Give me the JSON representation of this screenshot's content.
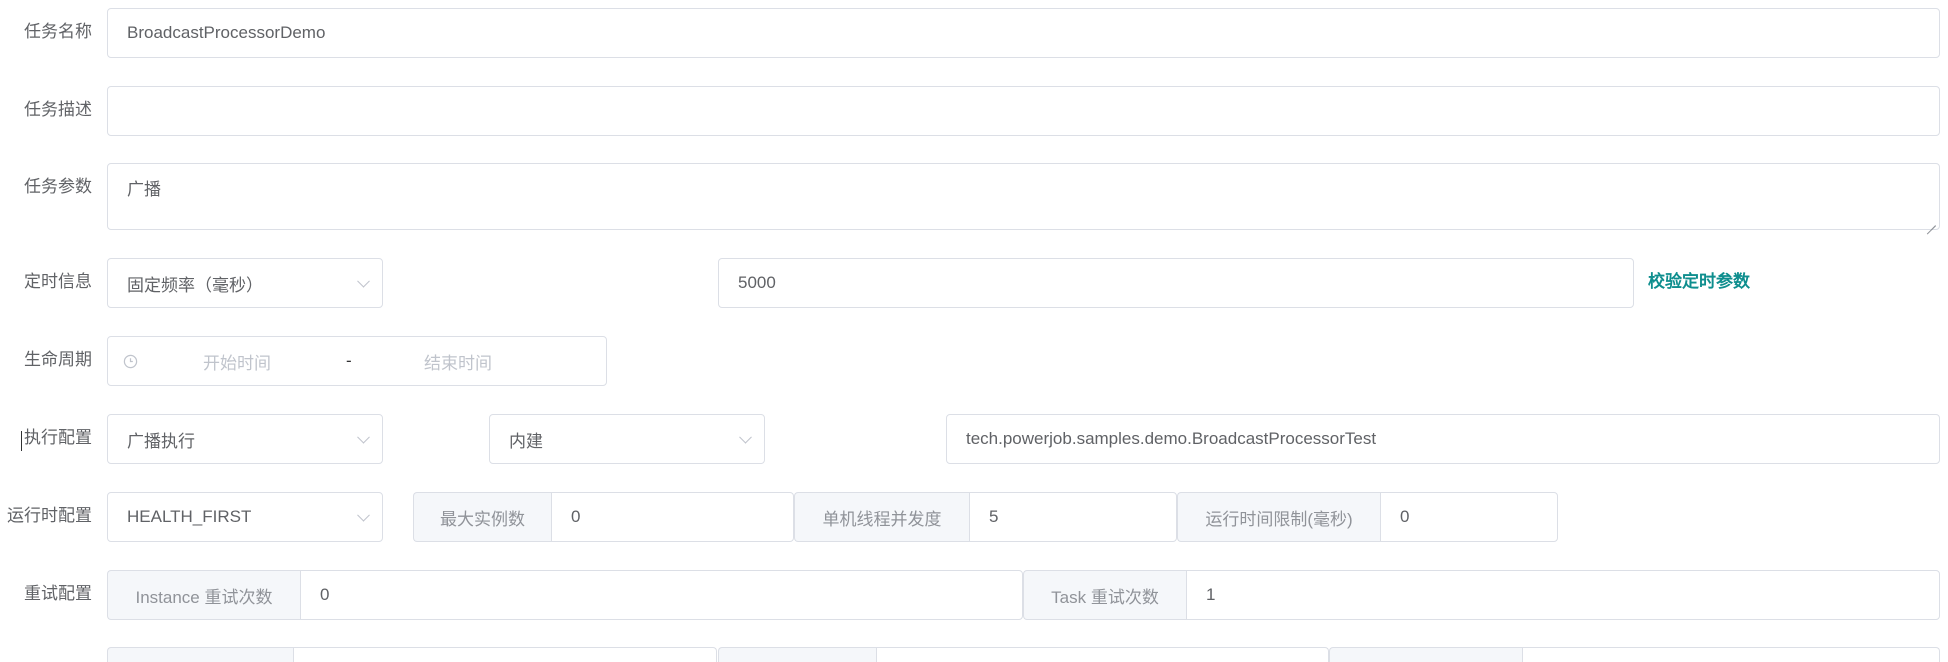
{
  "form": {
    "task_name": {
      "label": "任务名称",
      "value": "BroadcastProcessorDemo"
    },
    "task_desc": {
      "label": "任务描述",
      "value": ""
    },
    "task_params": {
      "label": "任务参数",
      "value": "广播"
    },
    "timing": {
      "label": "定时信息",
      "type_value": "固定频率（毫秒）",
      "expression_value": "5000",
      "validate_link": "校验定时参数"
    },
    "lifecycle": {
      "label": "生命周期",
      "start_placeholder": "开始时间",
      "separator": "-",
      "end_placeholder": "结束时间"
    },
    "execution": {
      "label": "执行配置",
      "mode_value": "广播执行",
      "processor_type_value": "内建",
      "processor_info_value": "tech.powerjob.samples.demo.BroadcastProcessorTest"
    },
    "runtime": {
      "label": "运行时配置",
      "dispatch_strategy_value": "HEALTH_FIRST",
      "max_instances_label": "最大实例数",
      "max_instances_value": "0",
      "concurrency_label": "单机线程并发度",
      "concurrency_value": "5",
      "time_limit_label": "运行时间限制(毫秒)",
      "time_limit_value": "0"
    },
    "retry": {
      "label": "重试配置",
      "instance_retry_label": "Instance 重试次数",
      "instance_retry_value": "0",
      "task_retry_label": "Task 重试次数",
      "task_retry_value": "1"
    }
  },
  "icons": {
    "clock": "clock-icon",
    "dropdown": "chevron-down-icon"
  },
  "colors": {
    "link": "#0e8e8e",
    "border": "#dcdfe6",
    "prepend_bg": "#f5f7fa"
  }
}
